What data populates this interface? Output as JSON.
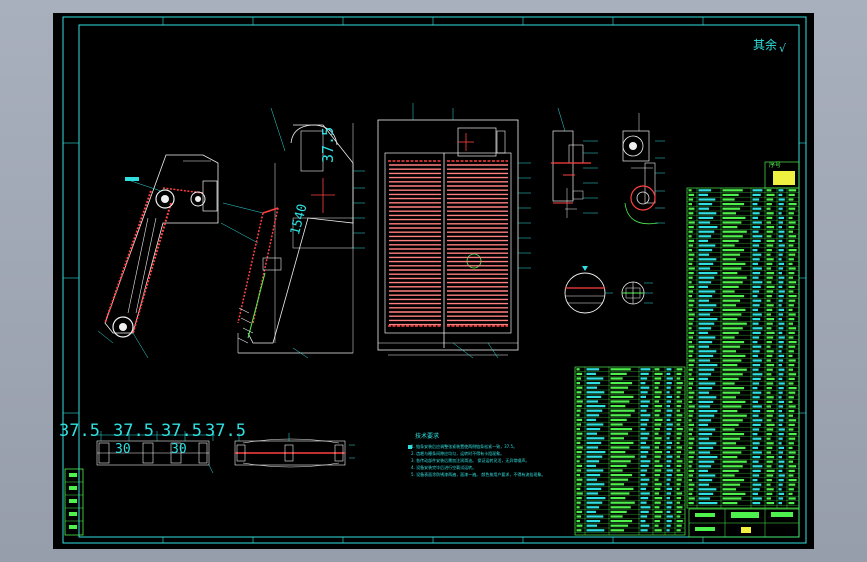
{
  "drawing": {
    "title_mark": "其余",
    "dimensions_bottom": [
      "37.5",
      "37.5",
      "37.5",
      "37.5"
    ],
    "dimensions_bottom_inner": [
      "30",
      "30"
    ],
    "dimension_side_top": "37.5",
    "dimension_side_lower": "1540",
    "table_header_label": "序号",
    "notes_title": "技术要求",
    "notes_lines": [
      "1. 链条安装后应调整张紧装置使两侧链条松紧一致，37.5。",
      "2. 齿耙与栅条间隙应均匀，运转时不得有卡阻现象。",
      "3. 各传动部件安装后需加注润滑油。   保证运转灵活，无异常噪声。",
      "4. 设备安装完毕后进行空载试运转。",
      "5. 设备表面涂防锈漆两遍，面漆一遍。   颜色按用户要求，不得有流挂现象。"
    ]
  },
  "colors": {
    "background": "#000000",
    "cyan": "#30e0e0",
    "green": "#4ef04e",
    "white": "#f0f0f0",
    "red": "#ff4040",
    "yellow": "#f0f040"
  }
}
